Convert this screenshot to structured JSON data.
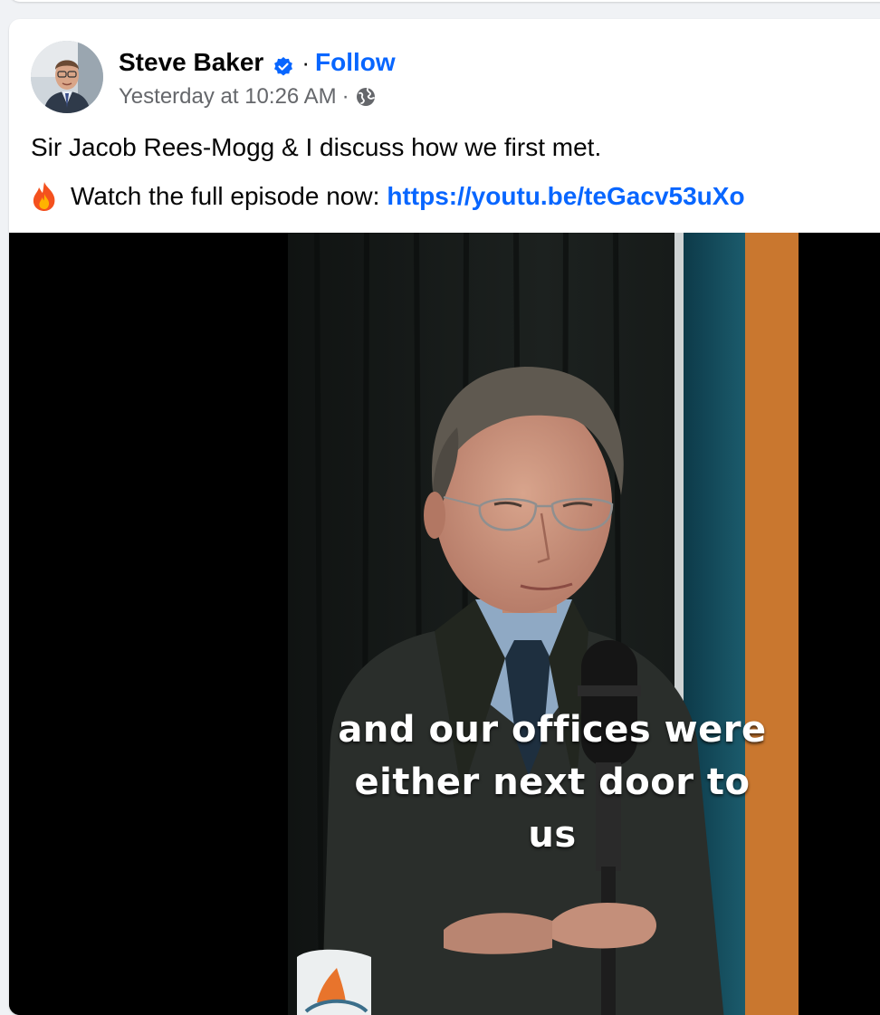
{
  "post": {
    "author": "Steve Baker",
    "verified_icon": "verified-badge-icon",
    "separator": "·",
    "follow_label": "Follow",
    "timestamp": "Yesterday at 10:26 AM",
    "audience_icon": "globe-icon",
    "caption_line1": "Sir Jacob Rees-Mogg & I discuss how we first met.",
    "caption_line2_text": "Watch the full episode now:",
    "caption_emoji": "fire-emoji-icon",
    "link": "https://youtu.be/teGacv53uXo"
  },
  "video": {
    "subtitle_line1": "and our offices were",
    "subtitle_line2": "either next door to",
    "subtitle_line3": "us"
  },
  "colors": {
    "link_blue": "#0866ff",
    "meta_gray": "#65676b",
    "page_bg": "#f0f2f5"
  }
}
